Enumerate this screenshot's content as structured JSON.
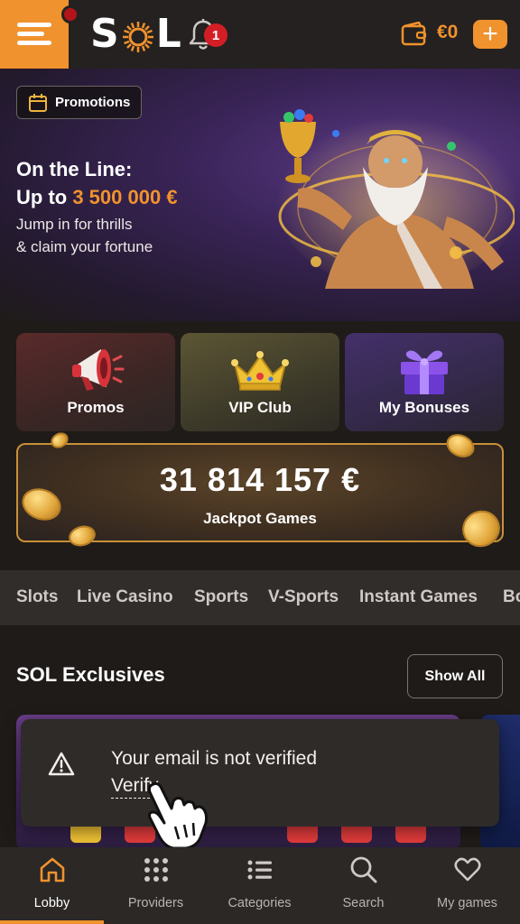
{
  "header": {
    "logo_text_left": "S",
    "logo_text_right": "L",
    "notification_count": "1",
    "balance": "€0",
    "add_label": "+"
  },
  "hero": {
    "tag_label": "Promotions",
    "title_line1": "On the Line:",
    "title_line2_prefix": "Up to ",
    "title_amount": "3 500 000 €",
    "subtitle_line1": "Jump in for thrills",
    "subtitle_line2": "& claim your fortune"
  },
  "tiles": [
    {
      "label": "Promos",
      "icon": "megaphone-icon"
    },
    {
      "label": "VIP Club",
      "icon": "crown-icon"
    },
    {
      "label": "My Bonuses",
      "icon": "gift-icon"
    }
  ],
  "jackpot": {
    "amount": "31 814 157 €",
    "label": "Jackpot Games"
  },
  "categories": [
    "Slots",
    "Live Casino",
    "Sports",
    "V-Sports",
    "Instant Games",
    "Bo"
  ],
  "exclusives": {
    "title": "SOL Exclusives",
    "show_all_label": "Show All"
  },
  "toast": {
    "message": "Your email is not verified",
    "link_label": "Verify",
    "icon": "warning-icon"
  },
  "bottom_nav": [
    {
      "label": "Lobby",
      "icon": "home-icon",
      "active": true
    },
    {
      "label": "Providers",
      "icon": "grid-icon",
      "active": false
    },
    {
      "label": "Categories",
      "icon": "list-icon",
      "active": false
    },
    {
      "label": "Search",
      "icon": "search-icon",
      "active": false
    },
    {
      "label": "My games",
      "icon": "heart-icon",
      "active": false
    }
  ],
  "colors": {
    "accent": "#f0922d",
    "background": "#1f1b19",
    "badge_red": "#d41e26"
  }
}
